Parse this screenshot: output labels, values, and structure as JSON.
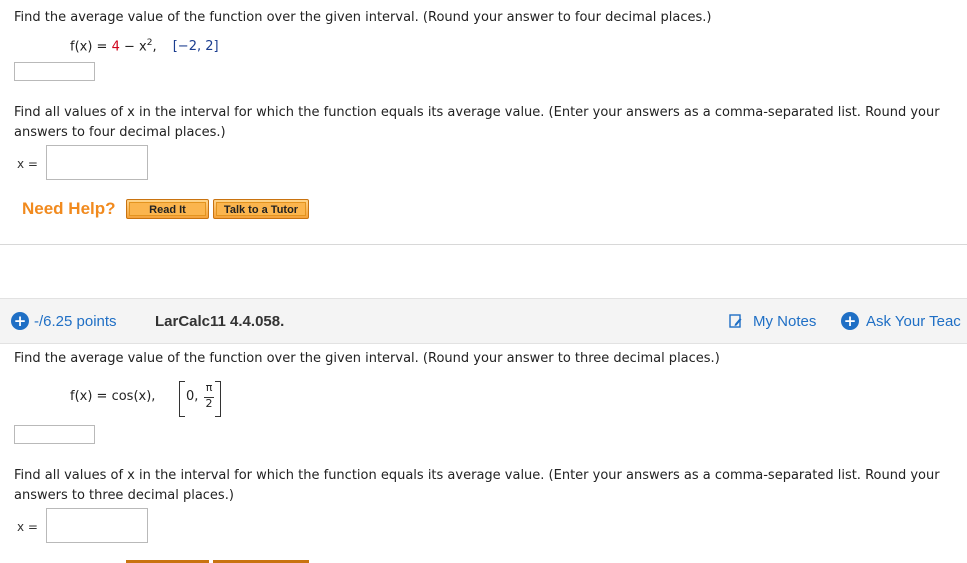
{
  "q1": {
    "prompt": "Find the average value of the function over the given interval. (Round your answer to four decimal places.)",
    "func_lhs": "f(x) = ",
    "func_const": "4",
    "func_rest": " − x",
    "func_exp": "2",
    "func_comma": ",",
    "interval": "[−2, 2]",
    "prompt2_line1": "Find all values of x in the interval for which the function equals its average value. (Enter your answers as a comma-separated list. Round your",
    "prompt2_line2": "answers to four decimal places.)",
    "x_label": "x =",
    "need_help": "Need Help?",
    "read_it": "Read It",
    "talk_tutor": "Talk to a Tutor"
  },
  "q2": {
    "points": "-/6.25 points",
    "qid": "LarCalc11 4.4.058.",
    "my_notes": "My Notes",
    "ask_teacher": "Ask Your Teac",
    "prompt": "Find the average value of the function over the given interval. (Round your answer to three decimal places.)",
    "func": "f(x) = cos(x),",
    "interval_start": "0,",
    "interval_num": "π",
    "interval_den": "2",
    "prompt2_line1": "Find all values of x in the interval for which the function equals its average value. (Enter your answers as a comma-separated list. Round your",
    "prompt2_line2": "answers to three decimal places.)",
    "x_label": "x ="
  },
  "colors": {
    "accent_blue": "#1f6fc5",
    "help_orange": "#f18a1e",
    "red": "#d0021b"
  }
}
